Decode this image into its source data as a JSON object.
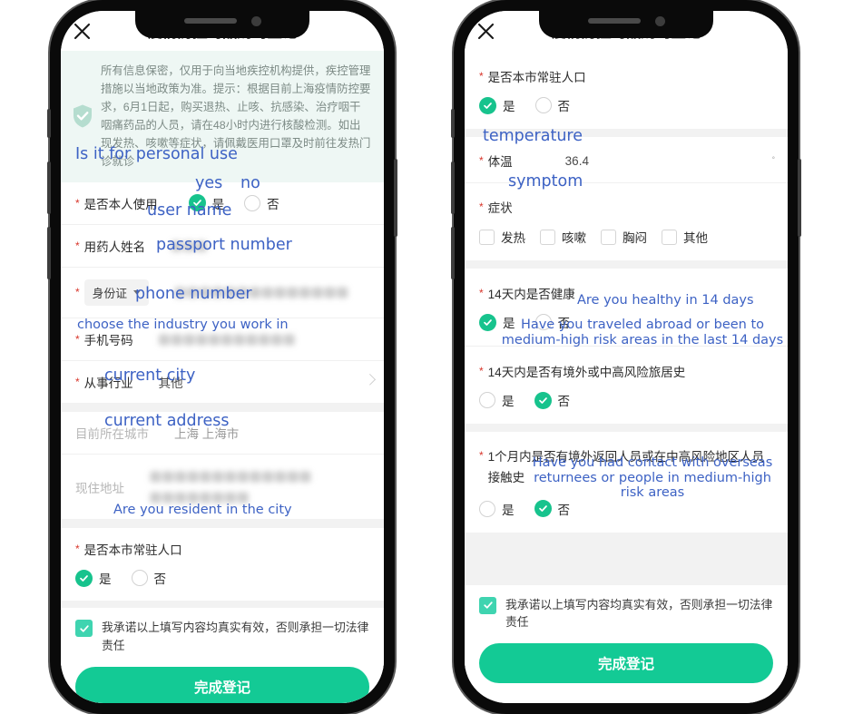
{
  "app": {
    "title": "疫情防控约品购约登记",
    "close_icon": "close-icon"
  },
  "notice": {
    "icon": "shield-check-icon",
    "text": "所有信息保密，仅用于向当地疾控机构提供，疾控管理措施以当地政策为准。提示：根据目前上海疫情防控要求，6月1日起，购买退热、止咳、抗感染、治疗咽干咽痛药品的人员，请在48小时内进行核酸检测。如出现发热、咳嗽等症状，请佩戴医用口罩及时前往发热门诊就诊"
  },
  "screen1": {
    "personal_use": {
      "label": "是否本人使用",
      "yes": "是",
      "no": "否",
      "selected": "yes"
    },
    "user_name": {
      "label": "用药人姓名",
      "value": "▨▨▨"
    },
    "id_type": {
      "label_star": "*",
      "dropdown": "身份证",
      "value": "▨▨▨▨▨▨▨▨▨▨▨▨▨▨"
    },
    "phone": {
      "label": "手机号码",
      "value": "▨▨▨▨▨▨▨▨▨▨▨"
    },
    "industry": {
      "label": "从事行业",
      "value": "其他"
    },
    "city": {
      "label": "目前所在城市",
      "value": "上海 上海市"
    },
    "address": {
      "label": "现住地址",
      "value": "▨▨▨▨▨▨▨▨▨▨▨▨▨ ▨▨▨▨▨▨▨▨"
    },
    "resident": {
      "label": "是否本市常驻人口",
      "yes": "是",
      "no": "否",
      "selected": "yes"
    }
  },
  "screen2": {
    "resident": {
      "label": "是否本市常驻人口",
      "yes": "是",
      "no": "否",
      "selected": "yes"
    },
    "temperature": {
      "label": "体温",
      "value": "36.4",
      "unit": "°"
    },
    "symptom": {
      "label": "症状",
      "options": [
        "发热",
        "咳嗽",
        "胸闷",
        "其他"
      ],
      "checked": []
    },
    "healthy14": {
      "label": "14天内是否健康",
      "yes": "是",
      "no": "否",
      "selected": "yes"
    },
    "travel14": {
      "label": "14天内是否有境外或中高风险旅居史",
      "yes": "是",
      "no": "否",
      "selected": "no"
    },
    "contact1m": {
      "label": "1个月内是否有境外返回人员或在中高风险地区人员接触史",
      "yes": "是",
      "no": "否",
      "selected": "no"
    }
  },
  "footer": {
    "agree_text": "我承诺以上填写内容均真实有效，否则承担一切法律责任",
    "agree_checked": true,
    "submit_label": "完成登记"
  },
  "annotations": {
    "personal_use": "Is it for personal use",
    "yes": "yes",
    "no": "no",
    "user_name": "user name",
    "passport_number": "passport number",
    "phone_number": "phone number",
    "industry": "choose the industry you work in",
    "city": "current city",
    "address": "current address",
    "resident": "Are you resident in the city",
    "temperature": "temperature",
    "symptom": "symptom",
    "healthy14": "Are you healthy in 14 days",
    "travel14": "Have you traveled abroad or been to medium-high risk areas in the last 14 days",
    "contact1m": "Have you had contact with overseas returnees or people in medium-high risk areas"
  },
  "colors": {
    "accent_green": "#13ca95",
    "radio_green": "#17c38d",
    "checkbox_green": "#3fd4b0",
    "annotation_blue": "#3d62c4",
    "required_red": "#d8352a",
    "notice_bg": "#eef7f4"
  }
}
